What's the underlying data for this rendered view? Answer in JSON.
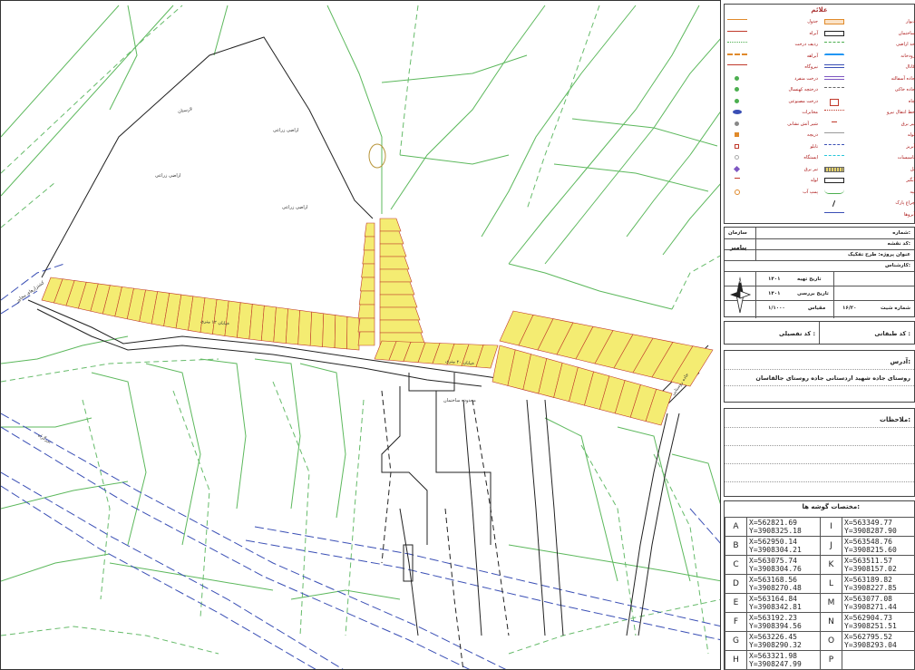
{
  "colors": {
    "parcel_fill": "#f4ec72",
    "parcel_stroke": "#c0392b",
    "green_line": "#4caf50",
    "green_dashed": "#66bb6a",
    "blue_dashed": "#3a4fb5",
    "black_line": "#222222"
  },
  "map": {
    "labels": {
      "hill": "لارستان",
      "left_village": "کشتزارهای مجاور",
      "main_road": "خیابان ۱۲ متری",
      "road_south": "خیابان ۲۰ متری",
      "road_east": "جاده روستایی",
      "field_1": "اراضی زراعی",
      "field_2": "اراضی زراعی",
      "field_3": "اراضی زراعی",
      "highway": "بزرگراه",
      "school": "محدوده ساختمان"
    }
  },
  "legend": {
    "title": "علائم",
    "left_items": [
      {
        "label": "جدول",
        "icon": "orange-line"
      },
      {
        "label": "آبراه",
        "icon": "red-line"
      },
      {
        "label": "ردیف درخت",
        "icon": "green-dotted-line"
      },
      {
        "label": "آبراهه",
        "icon": "orange-hatched-line"
      },
      {
        "label": "نیروگاه",
        "icon": "red-arrow-line"
      },
      {
        "label": "درخت منفرد",
        "icon": "green-dot"
      },
      {
        "label": "درختچه کهنسال",
        "icon": "green-dot"
      },
      {
        "label": "درخت مصنوعی",
        "icon": "green-dot"
      },
      {
        "label": "مخابرات",
        "icon": "blue-ellipse"
      },
      {
        "label": "شیر آتش نشانی",
        "icon": "gray-dot"
      },
      {
        "label": "دریچه",
        "icon": "orange-square"
      },
      {
        "label": "تابلو",
        "icon": "red-square"
      },
      {
        "label": "ایستگاه",
        "icon": "gray-circle"
      },
      {
        "label": "تیر برق",
        "icon": "purple-diamond"
      },
      {
        "label": "لوله",
        "icon": "red-t"
      },
      {
        "label": "پمپ آب",
        "icon": "orange-curve"
      }
    ],
    "right_items": [
      {
        "label": "دیوار",
        "icon": "orange-box"
      },
      {
        "label": "ساختمان",
        "icon": "black-box"
      },
      {
        "label": "حد اراضی",
        "icon": "green-dashed"
      },
      {
        "label": "رودخانه",
        "icon": "blue-wave"
      },
      {
        "label": "کانال",
        "icon": "blue-double-line"
      },
      {
        "label": "جاده آسفالته",
        "icon": "purple-double-line"
      },
      {
        "label": "جاده خاکی",
        "icon": "gray-dashed"
      },
      {
        "label": "چاه",
        "icon": "red-cross-box"
      },
      {
        "label": "خط انتقال نیرو",
        "icon": "red-dotted"
      },
      {
        "label": "تیر برق",
        "icon": "red-t"
      },
      {
        "label": "لوله",
        "icon": "gray-line"
      },
      {
        "label": "آبریز",
        "icon": "blue-dashed"
      },
      {
        "label": "تاسیسات",
        "icon": "cyan-dashed"
      },
      {
        "label": "پل",
        "icon": "hatched-box"
      },
      {
        "label": "آبگیر",
        "icon": "black-box"
      },
      {
        "label": "تپه",
        "icon": "green-curve"
      },
      {
        "label": "چراغ پارک",
        "icon": "black-slash"
      },
      {
        "label": "آبروها",
        "icon": "blue-line"
      }
    ]
  },
  "info": {
    "org_label": "سازمان",
    "org_logo": "پیامبر",
    "project_label": "شماره:",
    "field_1": "کد نقشه:",
    "field_2": "عنوان پروژه: طرح تفکیک",
    "date_label": "تاریخ تهیه",
    "date_value": "۱۴۰۱",
    "date_label_2": "تاریخ بررسی",
    "date_value_2": "۱۴۰۱",
    "scale_label": "مقیاس",
    "scale_value": "۱/۱۰۰۰",
    "sheet_label": "شماره شیت",
    "sheet_value": "۱۶/۲۰",
    "operator_label": "کارشناس:"
  },
  "code": {
    "label_left": "کد تفصیلی :",
    "label_right": "کد طبقاتی :"
  },
  "address": {
    "label": "آدرس:",
    "text": "روستای جاده شهید اردستانی جاده روستای جالقاسان"
  },
  "notes": {
    "label": "ملاحظات:"
  },
  "coords": {
    "title": "مختصات گوشه ها:",
    "rows": [
      {
        "l": "A",
        "x": "X=562821.69",
        "y": "Y=3908325.18",
        "r": "I",
        "rx": "X=563349.77",
        "ry": "Y=3908287.90"
      },
      {
        "l": "B",
        "x": "X=562950.14",
        "y": "Y=3908304.21",
        "r": "J",
        "rx": "X=563548.76",
        "ry": "Y=3908215.60"
      },
      {
        "l": "C",
        "x": "X=563075.74",
        "y": "Y=3908304.76",
        "r": "K",
        "rx": "X=563511.57",
        "ry": "Y=3908157.02"
      },
      {
        "l": "D",
        "x": "X=563168.56",
        "y": "Y=3908270.48",
        "r": "L",
        "rx": "X=563189.82",
        "ry": "Y=3908227.85"
      },
      {
        "l": "E",
        "x": "X=563164.84",
        "y": "Y=3908342.81",
        "r": "M",
        "rx": "X=563077.08",
        "ry": "Y=3908271.44"
      },
      {
        "l": "F",
        "x": "X=563192.23",
        "y": "Y=3908394.56",
        "r": "N",
        "rx": "X=562904.73",
        "ry": "Y=3908251.51"
      },
      {
        "l": "G",
        "x": "X=563226.45",
        "y": "Y=3908290.32",
        "r": "O",
        "rx": "X=562795.52",
        "ry": "Y=3908293.04"
      },
      {
        "l": "H",
        "x": "X=563321.98",
        "y": "Y=3908247.99",
        "r": "P",
        "rx": "",
        "ry": ""
      }
    ]
  }
}
